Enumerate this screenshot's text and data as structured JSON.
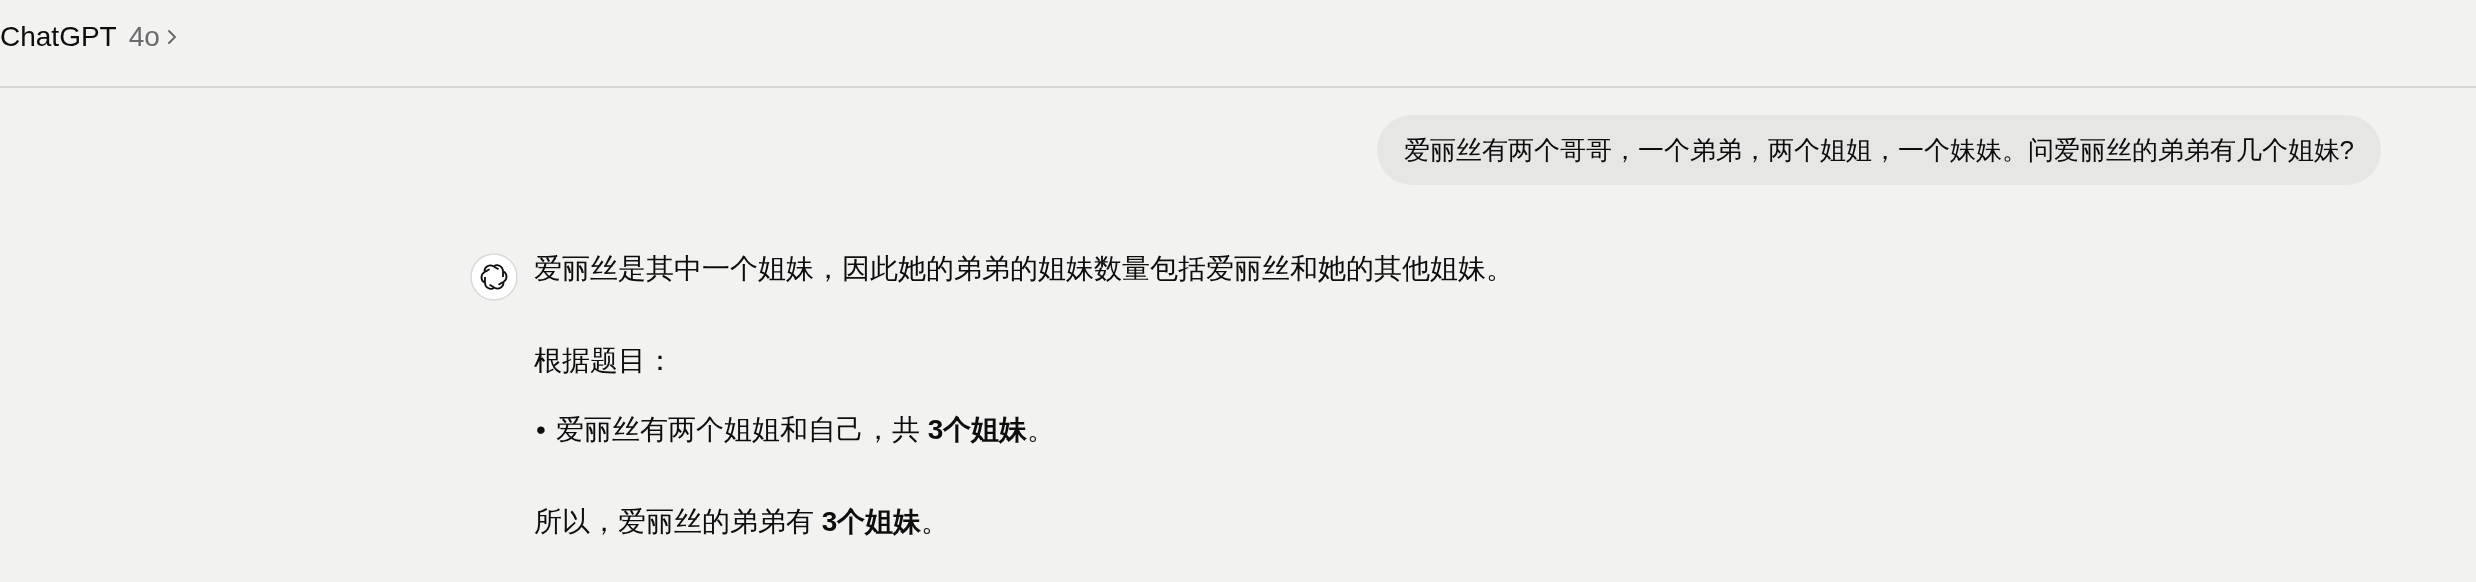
{
  "header": {
    "title": "ChatGPT",
    "model": "4o"
  },
  "user_message": "爱丽丝有两个哥哥，一个弟弟，两个姐姐，一个妹妹。问爱丽丝的弟弟有几个姐妹?",
  "assistant_message": {
    "paragraphs": [
      {
        "kind": "text",
        "text": "爱丽丝是其中一个姐妹，因此她的弟弟的姐妹数量包括爱丽丝和她的其他姐妹。"
      },
      {
        "kind": "text",
        "text": "根据题目："
      },
      {
        "kind": "bullet",
        "marker": "•",
        "text": "爱丽丝有两个姐姐和自己，共 **3个姐妹**。"
      },
      {
        "kind": "text",
        "text": "所以，爱丽丝的弟弟有 **3个姐妹**。"
      }
    ]
  }
}
